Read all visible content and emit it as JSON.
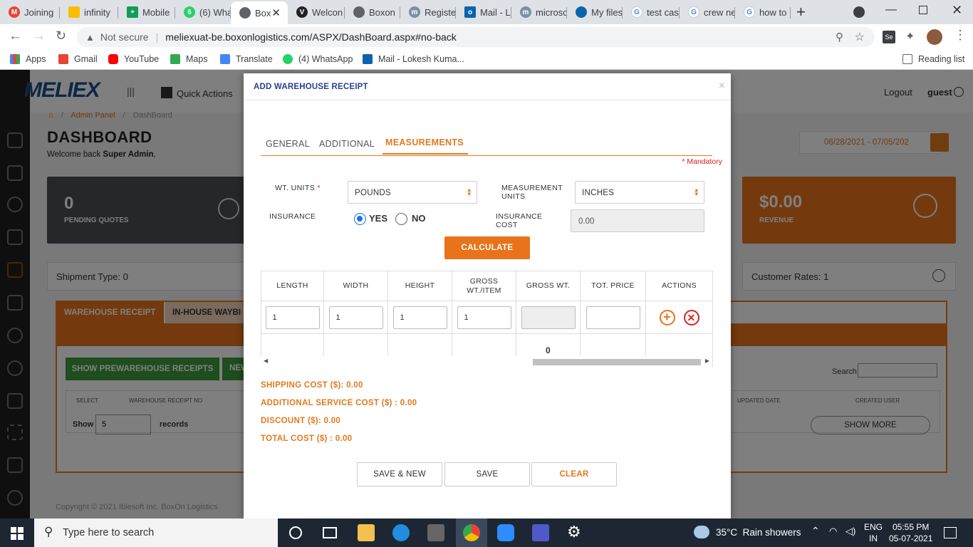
{
  "browser": {
    "tabs": [
      "Joining",
      "infinity",
      "Mobile",
      "(6) Wha",
      "Box",
      "Welcon",
      "Boxon",
      "Registe",
      "Mail - L",
      "microsc",
      "My files",
      "test cas",
      "crew ne",
      "how to"
    ],
    "url_security": "Not secure",
    "url": "meliexuat-be.boxonlogistics.com/ASPX/DashBoard.aspx#no-back",
    "bookmarks": [
      "Apps",
      "Gmail",
      "YouTube",
      "Maps",
      "Translate",
      "(4) WhatsApp",
      "Mail - Lokesh Kuma..."
    ],
    "reading_list": "Reading list"
  },
  "app": {
    "logo": "MELIEX",
    "quick_actions": "Quick Actions",
    "logout": "Logout",
    "user": "guest",
    "breadcrumb": [
      "Admin Panel",
      "DashBoard"
    ],
    "page_title": "DASHBOARD",
    "welcome_prefix": "Welcome back ",
    "welcome_user": "Super Admin",
    "welcome_suffix": ",",
    "date_range": "06/28/2021 - 07/05/202",
    "stats": {
      "pending_value": "0",
      "pending_label": "PENDING QUOTES",
      "revenue_value": "$0.00",
      "revenue_label": "REVENUE"
    },
    "shipment_type": "Shipment Type: 0",
    "customer_rates": "Customer Rates: 1",
    "bottom_tabs": [
      "WAREHOUSE RECEIPT",
      "IN-HOUSE WAYBI"
    ],
    "show_prewarehouse": "SHOW PREWAREHOUSE RECEIPTS",
    "new_btn": "NEW",
    "search_label": "Search",
    "table_headers": [
      "SELECT",
      "WAREHOUSE RECEIPT NO",
      "UPDATED DATE",
      "CREATED USER"
    ],
    "show_label": "Show",
    "show_value": "5",
    "records_label": "records",
    "show_more": "SHOW MORE",
    "footer": "Copyright © 2021 Iblesoft Inc.  BoxOn Logistics"
  },
  "modal": {
    "title": "ADD WAREHOUSE RECEIPT",
    "close": "×",
    "tabs": [
      "GENERAL",
      "ADDITIONAL",
      "MEASUREMENTS"
    ],
    "mandatory": "* Mandatory",
    "wt_units_label": "WT. UNITS",
    "wt_units_value": "POUNDS",
    "measurement_units_label_1": "MEASUREMENT",
    "measurement_units_label_2": "UNITS",
    "measurement_units_value": "INCHES",
    "insurance_label": "INSURANCE",
    "insurance_yes": "YES",
    "insurance_no": "NO",
    "insurance_cost_label_1": "INSURANCE",
    "insurance_cost_label_2": "COST",
    "insurance_cost_value": "0.00",
    "calculate": "CALCULATE",
    "grid_headers": [
      "LENGTH",
      "WIDTH",
      "HEIGHT",
      "GROSS WT./ITEM",
      "GROSS WT.",
      "TOT. PRICE",
      "ACTIONS"
    ],
    "grid_row": {
      "length": "1",
      "width": "1",
      "height": "1",
      "gross_wt_item": "1",
      "gross_wt": "",
      "tot_price": ""
    },
    "grid_total_gross_wt": "0",
    "costs": [
      {
        "label": "SHIPPING COST ($):",
        "value": "0.00"
      },
      {
        "label": "ADDITIONAL SERVICE COST ($) :",
        "value": "0.00"
      },
      {
        "label": "DISCOUNT ($):",
        "value": "0.00"
      },
      {
        "label": "TOTAL COST ($) :",
        "value": "0.00"
      }
    ],
    "buttons": {
      "save_new": "SAVE & NEW",
      "save": "SAVE",
      "clear": "CLEAR"
    }
  },
  "taskbar": {
    "search_placeholder": "Type here to search",
    "weather": "35°C  Rain showers",
    "lang_1": "ENG",
    "lang_2": "IN",
    "time": "05:55 PM",
    "date": "05-07-2021"
  },
  "colors": {
    "accent": "#e07a1e",
    "modal_title": "#2c3e8f",
    "tab_strip": "#dee1e6",
    "taskbar": "#1d2733"
  }
}
